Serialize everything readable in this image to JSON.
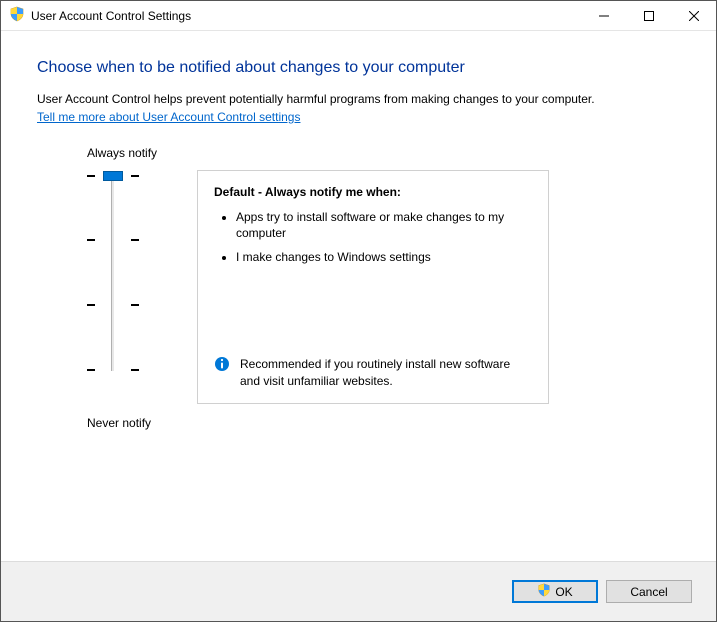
{
  "window": {
    "title": "User Account Control Settings"
  },
  "header": {
    "heading": "Choose when to be notified about changes to your computer",
    "intro": "User Account Control helps prevent potentially harmful programs from making changes to your computer.",
    "link": "Tell me more about User Account Control settings"
  },
  "slider": {
    "top_label": "Always notify",
    "bottom_label": "Never notify",
    "levels": 4,
    "current_level": 0
  },
  "description": {
    "title": "Default - Always notify me when:",
    "bullets": [
      "Apps try to install software or make changes to my computer",
      "I make changes to Windows settings"
    ],
    "recommendation": "Recommended if you routinely install new software and visit unfamiliar websites."
  },
  "footer": {
    "ok_label": "OK",
    "cancel_label": "Cancel"
  }
}
